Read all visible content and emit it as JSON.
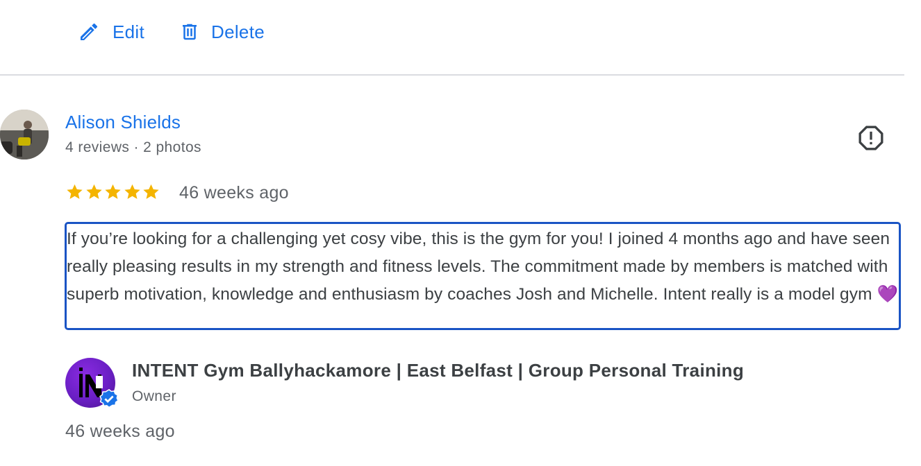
{
  "actions": {
    "edit_label": "Edit",
    "delete_label": "Delete"
  },
  "review": {
    "reviewer_name": "Alison Shields",
    "reviewer_meta": "4 reviews · 2 photos",
    "rating": 5,
    "max_rating": 5,
    "date": "46 weeks ago",
    "text": "If you’re looking for a challenging yet cosy vibe, this is the gym for you! I joined 4 months ago and have seen really pleasing results in my strength and fitness levels. The commitment made by members is matched with superb motivation, knowledge and enthusiasm by coaches Josh and Michelle. Intent really is a model gym 💜"
  },
  "owner_reply": {
    "business_name": "INTENT Gym Ballyhackamore | East Belfast | Group Personal Training",
    "role": "Owner",
    "date": "46 weeks ago"
  },
  "icons": {
    "edit": "pencil-icon",
    "delete": "trash-icon",
    "report": "report-flag-icon",
    "verified": "verified-badge-icon"
  },
  "colors": {
    "link_blue": "#1a73e8",
    "star_gold": "#f4b400",
    "focus_border": "#1a54c4",
    "owner_purple": "#6a1fc4"
  }
}
